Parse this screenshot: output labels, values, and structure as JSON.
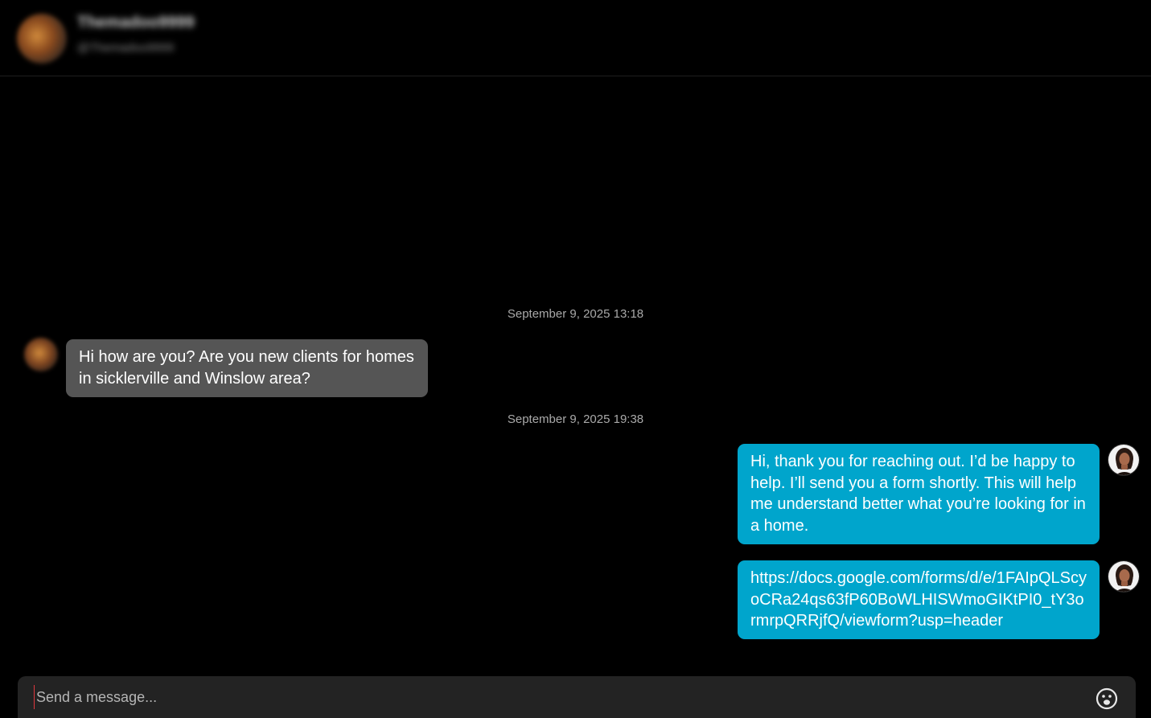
{
  "header": {
    "name": "Themadoo9999",
    "handle": "@Themadoo9999"
  },
  "conversation": {
    "groups": [
      {
        "timestamp": "September 9, 2025 13:18",
        "messages": [
          {
            "direction": "incoming",
            "text": "Hi how are you? Are you new clients for homes in sicklerville and Winslow area?"
          }
        ]
      },
      {
        "timestamp": "September 9, 2025 19:38",
        "messages": [
          {
            "direction": "outgoing",
            "text": "Hi, thank you for reaching out. I’d be happy to help. I’ll send you a form shortly. This will help me understand better what you’re looking for in a home."
          },
          {
            "direction": "outgoing",
            "text": "https://docs.google.com/forms/d/e/1FAIpQLScyoCRa24qs63fP60BoWLHISWmoGIKtPI0_tY3ormrpQRRjfQ/viewform?usp=header"
          }
        ]
      }
    ]
  },
  "composer": {
    "placeholder": "Send a message...",
    "value": "",
    "emoji_icon": "smiley-face-icon"
  },
  "colors": {
    "background": "#000000",
    "incoming_bubble": "#555555",
    "outgoing_bubble": "#00a5cc",
    "composer_bg": "#232323",
    "timestamp_text": "#a9a9a9"
  }
}
